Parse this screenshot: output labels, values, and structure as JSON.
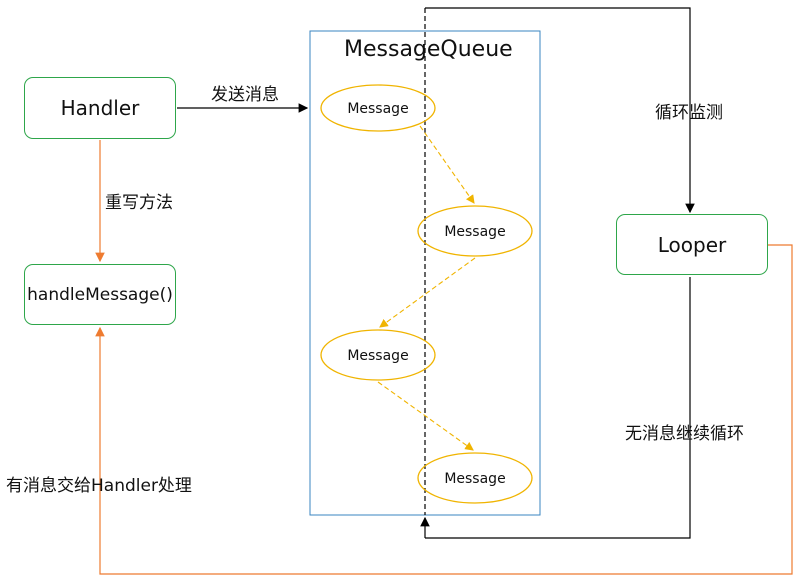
{
  "handler": "Handler",
  "handle_message": "handleMessage()",
  "queue_title": "MessageQueue",
  "messages": [
    "Message",
    "Message",
    "Message",
    "Message"
  ],
  "looper": "Looper",
  "labels": {
    "send": "发送消息",
    "override": "重写方法",
    "loop_monitor": "循环监测",
    "no_message": "无消息继续循环",
    "has_message": "有消息交给Handler处理"
  },
  "colors": {
    "box_border": "#2ea64a",
    "queue_border": "#3a86c0",
    "message_border": "#f0b400",
    "orange_line": "#ee7b30",
    "black_line": "#000000"
  }
}
